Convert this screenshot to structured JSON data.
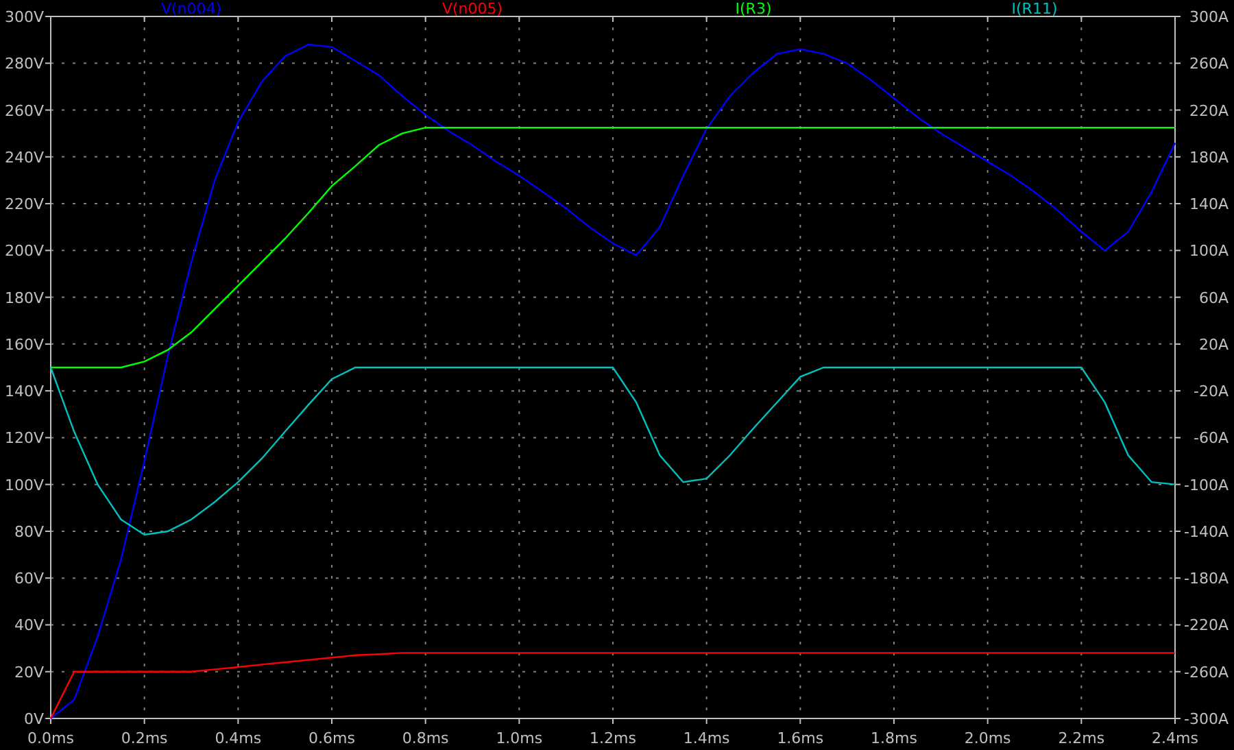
{
  "chart_data": {
    "type": "line",
    "grid": true,
    "x": [
      0,
      0.05,
      0.1,
      0.15,
      0.2,
      0.25,
      0.3,
      0.35,
      0.4,
      0.45,
      0.5,
      0.55,
      0.6,
      0.65,
      0.7,
      0.75,
      0.8,
      0.85,
      0.9,
      0.95,
      1.0,
      1.05,
      1.1,
      1.15,
      1.2,
      1.25,
      1.3,
      1.35,
      1.4,
      1.45,
      1.5,
      1.55,
      1.6,
      1.65,
      1.7,
      1.75,
      1.8,
      1.85,
      1.9,
      1.95,
      2.0,
      2.05,
      2.1,
      2.15,
      2.2,
      2.25,
      2.3,
      2.35,
      2.4
    ],
    "xlim": [
      0,
      2.4
    ],
    "ylim": [
      0,
      300
    ],
    "xticks": [
      {
        "value": 0,
        "label": "0.0ms"
      },
      {
        "value": 0.2,
        "label": "0.2ms"
      },
      {
        "value": 0.4,
        "label": "0.4ms"
      },
      {
        "value": 0.6,
        "label": "0.6ms"
      },
      {
        "value": 0.8,
        "label": "0.8ms"
      },
      {
        "value": 1.0,
        "label": "1.0ms"
      },
      {
        "value": 1.2,
        "label": "1.2ms"
      },
      {
        "value": 1.4,
        "label": "1.4ms"
      },
      {
        "value": 1.6,
        "label": "1.6ms"
      },
      {
        "value": 1.8,
        "label": "1.8ms"
      },
      {
        "value": 2.0,
        "label": "2.0ms"
      },
      {
        "value": 2.2,
        "label": "2.2ms"
      },
      {
        "value": 2.4,
        "label": "2.4ms"
      }
    ],
    "yticks": [
      {
        "value": 300,
        "label": "300V"
      },
      {
        "value": 280,
        "label": "280V"
      },
      {
        "value": 260,
        "label": "260V"
      },
      {
        "value": 240,
        "label": "240V"
      },
      {
        "value": 220,
        "label": "220V"
      },
      {
        "value": 200,
        "label": "200V"
      },
      {
        "value": 180,
        "label": "180V"
      },
      {
        "value": 160,
        "label": "160V"
      },
      {
        "value": 140,
        "label": "140V"
      },
      {
        "value": 120,
        "label": "120V"
      },
      {
        "value": 100,
        "label": "100V"
      },
      {
        "value": 80,
        "label": "80V"
      },
      {
        "value": 60,
        "label": "60V"
      },
      {
        "value": 40,
        "label": "40V"
      },
      {
        "value": 20,
        "label": "20V"
      },
      {
        "value": 0,
        "label": "0V"
      }
    ],
    "y2lim": [
      -300,
      300
    ],
    "y2ticks": [
      {
        "value": 300,
        "label": "300A"
      },
      {
        "value": 260,
        "label": "260A"
      },
      {
        "value": 220,
        "label": "220A"
      },
      {
        "value": 180,
        "label": "180A"
      },
      {
        "value": 140,
        "label": "140A"
      },
      {
        "value": 100,
        "label": "100A"
      },
      {
        "value": 60,
        "label": "60A"
      },
      {
        "value": 20,
        "label": "20A"
      },
      {
        "value": -20,
        "label": "-20A"
      },
      {
        "value": -60,
        "label": "-60A"
      },
      {
        "value": -100,
        "label": "-100A"
      },
      {
        "value": -140,
        "label": "-140A"
      },
      {
        "value": -180,
        "label": "-180A"
      },
      {
        "value": -220,
        "label": "-220A"
      },
      {
        "value": -260,
        "label": "-260A"
      },
      {
        "value": -300,
        "label": "-300A"
      }
    ],
    "series": [
      {
        "name": "V(n004)",
        "color": "#0000ff",
        "values": [
          0,
          8,
          35,
          68,
          110,
          155,
          195,
          230,
          255,
          272,
          283,
          288,
          287,
          281,
          275,
          266,
          258,
          251,
          245,
          238,
          232,
          225,
          218,
          210,
          203,
          198,
          210,
          232,
          252,
          266,
          276,
          284,
          286,
          284,
          280,
          273,
          265,
          257,
          250,
          244,
          238,
          232,
          225,
          217,
          208,
          200,
          208,
          225,
          246
        ]
      },
      {
        "name": "V(n005)",
        "color": "#ff0000",
        "values": [
          0,
          20,
          20,
          20,
          20,
          20,
          20,
          21,
          22,
          23,
          24,
          25,
          26,
          27,
          27.5,
          28,
          28,
          28,
          28,
          28,
          28,
          28,
          28,
          28,
          28,
          28,
          28,
          28,
          28,
          28,
          28,
          28,
          28,
          28,
          28,
          28,
          28,
          28,
          28,
          28,
          28,
          28,
          28,
          28,
          28,
          28,
          28,
          28,
          28
        ]
      },
      {
        "name": "I(R3)",
        "color": "#00ff00",
        "axis": "y2",
        "values": [
          0,
          0,
          0,
          0,
          5,
          15,
          30,
          50,
          70,
          90,
          110,
          132,
          155,
          172,
          190,
          200,
          205,
          205,
          205,
          205,
          205,
          205,
          205,
          205,
          205,
          205,
          205,
          205,
          205,
          205,
          205,
          205,
          205,
          205,
          205,
          205,
          205,
          205,
          205,
          205,
          205,
          205,
          205,
          205,
          205,
          205,
          205,
          205,
          205
        ]
      },
      {
        "name": "I(R11)",
        "color": "#00c0c0",
        "axis": "y2",
        "values": [
          0,
          -55,
          -100,
          -130,
          -143,
          -140,
          -130,
          -115,
          -98,
          -78,
          -55,
          -32,
          -10,
          0,
          0,
          0,
          0,
          0,
          0,
          0,
          0,
          0,
          0,
          0,
          0,
          -30,
          -75,
          -98,
          -95,
          -75,
          -52,
          -30,
          -8,
          0,
          0,
          0,
          0,
          0,
          0,
          0,
          0,
          0,
          0,
          0,
          0,
          -30,
          -75,
          -98,
          -100
        ]
      }
    ]
  }
}
